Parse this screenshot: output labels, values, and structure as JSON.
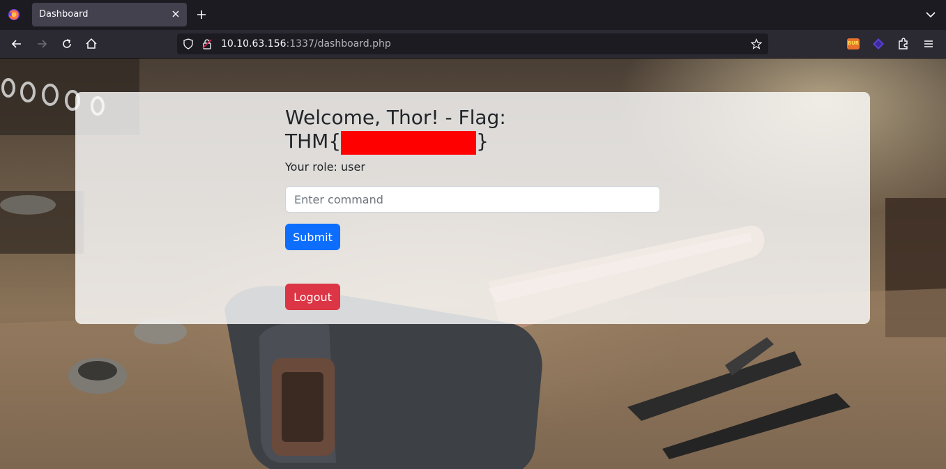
{
  "browser": {
    "tab_title": "Dashboard",
    "url_host": "10.10.63.156",
    "url_rest": ":1337/dashboard.php",
    "icons": [
      "firefox-logo-icon",
      "close-icon",
      "plus-icon",
      "chevron-down-icon",
      "back-icon",
      "forward-icon",
      "reload-icon",
      "home-icon",
      "shield-icon",
      "lock-icon",
      "star-icon",
      "burp-extension-icon",
      "extension-icon",
      "puzzle-icon",
      "menu-icon"
    ]
  },
  "dashboard": {
    "welcome_line1": "Welcome, Thor! - Flag:",
    "flag_prefix": "THM{",
    "flag_suffix": "}",
    "role_text": "Your role: user",
    "command_placeholder": "Enter command",
    "submit_label": "Submit",
    "logout_label": "Logout"
  },
  "colors": {
    "primary": "#0d6efd",
    "danger": "#dc3545",
    "redaction": "#ff0000"
  }
}
